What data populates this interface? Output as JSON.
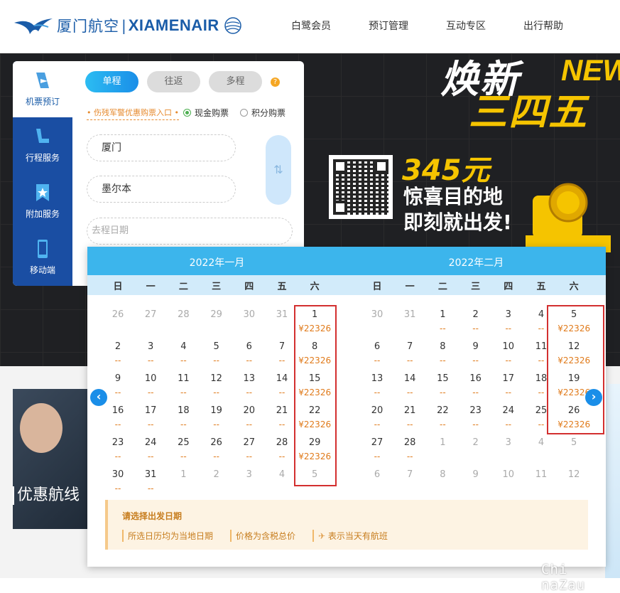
{
  "header": {
    "logo_cn": "厦门航空",
    "logo_en": "XIAMENAIR",
    "nav": [
      "白鹭会员",
      "预订管理",
      "互动专区",
      "出行帮助"
    ]
  },
  "banner": {
    "title1": "焕新",
    "title_new": "NEW",
    "title2": "三四五",
    "price": "345元",
    "line1": "惊喜目的地",
    "line2": "即刻就出发!"
  },
  "booking": {
    "side_items": [
      {
        "label": "机票预订",
        "icon": "plane-ticket-icon"
      },
      {
        "label": "行程服务",
        "icon": "seat-icon"
      },
      {
        "label": "附加服务",
        "icon": "bookmark-star-icon"
      },
      {
        "label": "移动端",
        "icon": "mobile-phone-icon"
      }
    ],
    "tabs": [
      "单程",
      "往返",
      "多程"
    ],
    "help": "?",
    "promo_link": "伤残军警优惠购票入口",
    "radio_cash": "现金购票",
    "radio_points": "积分购票",
    "from": "厦门",
    "to": "墨尔本",
    "swap": "⇅",
    "date_placeholder": "去程日期"
  },
  "calendar": {
    "months": [
      {
        "title": "2022年一月",
        "weekdays": [
          "日",
          "一",
          "二",
          "三",
          "四",
          "五",
          "六"
        ],
        "days": [
          {
            "n": "26",
            "p": "",
            "t": "gray"
          },
          {
            "n": "27",
            "p": "",
            "t": "gray"
          },
          {
            "n": "28",
            "p": "",
            "t": "gray"
          },
          {
            "n": "29",
            "p": "",
            "t": "gray"
          },
          {
            "n": "30",
            "p": "",
            "t": "gray"
          },
          {
            "n": "31",
            "p": "",
            "t": "gray"
          },
          {
            "n": "1",
            "p": "¥22326",
            "t": ""
          },
          {
            "n": "2",
            "p": "--",
            "t": ""
          },
          {
            "n": "3",
            "p": "--",
            "t": ""
          },
          {
            "n": "4",
            "p": "--",
            "t": ""
          },
          {
            "n": "5",
            "p": "--",
            "t": ""
          },
          {
            "n": "6",
            "p": "--",
            "t": ""
          },
          {
            "n": "7",
            "p": "--",
            "t": ""
          },
          {
            "n": "8",
            "p": "¥22326",
            "t": ""
          },
          {
            "n": "9",
            "p": "--",
            "t": ""
          },
          {
            "n": "10",
            "p": "--",
            "t": ""
          },
          {
            "n": "11",
            "p": "--",
            "t": ""
          },
          {
            "n": "12",
            "p": "--",
            "t": ""
          },
          {
            "n": "13",
            "p": "--",
            "t": ""
          },
          {
            "n": "14",
            "p": "--",
            "t": ""
          },
          {
            "n": "15",
            "p": "¥22326",
            "t": ""
          },
          {
            "n": "16",
            "p": "--",
            "t": ""
          },
          {
            "n": "17",
            "p": "--",
            "t": ""
          },
          {
            "n": "18",
            "p": "--",
            "t": ""
          },
          {
            "n": "19",
            "p": "--",
            "t": ""
          },
          {
            "n": "20",
            "p": "--",
            "t": ""
          },
          {
            "n": "21",
            "p": "--",
            "t": ""
          },
          {
            "n": "22",
            "p": "¥22326",
            "t": ""
          },
          {
            "n": "23",
            "p": "--",
            "t": ""
          },
          {
            "n": "24",
            "p": "--",
            "t": ""
          },
          {
            "n": "25",
            "p": "--",
            "t": ""
          },
          {
            "n": "26",
            "p": "--",
            "t": ""
          },
          {
            "n": "27",
            "p": "--",
            "t": ""
          },
          {
            "n": "28",
            "p": "--",
            "t": ""
          },
          {
            "n": "29",
            "p": "¥22326",
            "t": ""
          },
          {
            "n": "30",
            "p": "--",
            "t": ""
          },
          {
            "n": "31",
            "p": "--",
            "t": ""
          },
          {
            "n": "1",
            "p": "",
            "t": "gray"
          },
          {
            "n": "2",
            "p": "",
            "t": "gray"
          },
          {
            "n": "3",
            "p": "",
            "t": "gray"
          },
          {
            "n": "4",
            "p": "",
            "t": "gray"
          },
          {
            "n": "5",
            "p": "",
            "t": "gray"
          }
        ]
      },
      {
        "title": "2022年二月",
        "weekdays": [
          "日",
          "一",
          "二",
          "三",
          "四",
          "五",
          "六"
        ],
        "days": [
          {
            "n": "30",
            "p": "",
            "t": "gray"
          },
          {
            "n": "31",
            "p": "",
            "t": "gray"
          },
          {
            "n": "1",
            "p": "--",
            "t": ""
          },
          {
            "n": "2",
            "p": "--",
            "t": ""
          },
          {
            "n": "3",
            "p": "--",
            "t": ""
          },
          {
            "n": "4",
            "p": "--",
            "t": ""
          },
          {
            "n": "5",
            "p": "¥22326",
            "t": ""
          },
          {
            "n": "6",
            "p": "--",
            "t": ""
          },
          {
            "n": "7",
            "p": "--",
            "t": ""
          },
          {
            "n": "8",
            "p": "--",
            "t": ""
          },
          {
            "n": "9",
            "p": "--",
            "t": ""
          },
          {
            "n": "10",
            "p": "--",
            "t": ""
          },
          {
            "n": "11",
            "p": "--",
            "t": ""
          },
          {
            "n": "12",
            "p": "¥22326",
            "t": ""
          },
          {
            "n": "13",
            "p": "--",
            "t": ""
          },
          {
            "n": "14",
            "p": "--",
            "t": ""
          },
          {
            "n": "15",
            "p": "--",
            "t": ""
          },
          {
            "n": "16",
            "p": "--",
            "t": ""
          },
          {
            "n": "17",
            "p": "--",
            "t": ""
          },
          {
            "n": "18",
            "p": "--",
            "t": ""
          },
          {
            "n": "19",
            "p": "¥22326",
            "t": ""
          },
          {
            "n": "20",
            "p": "--",
            "t": ""
          },
          {
            "n": "21",
            "p": "--",
            "t": ""
          },
          {
            "n": "22",
            "p": "--",
            "t": ""
          },
          {
            "n": "23",
            "p": "--",
            "t": ""
          },
          {
            "n": "24",
            "p": "--",
            "t": ""
          },
          {
            "n": "25",
            "p": "--",
            "t": ""
          },
          {
            "n": "26",
            "p": "¥22326",
            "t": ""
          },
          {
            "n": "27",
            "p": "--",
            "t": ""
          },
          {
            "n": "28",
            "p": "--",
            "t": ""
          },
          {
            "n": "1",
            "p": "",
            "t": "gray"
          },
          {
            "n": "2",
            "p": "",
            "t": "gray"
          },
          {
            "n": "3",
            "p": "",
            "t": "gray"
          },
          {
            "n": "4",
            "p": "",
            "t": "gray"
          },
          {
            "n": "5",
            "p": "",
            "t": "gray"
          },
          {
            "n": "6",
            "p": "",
            "t": "gray"
          },
          {
            "n": "7",
            "p": "",
            "t": "gray"
          },
          {
            "n": "8",
            "p": "",
            "t": "gray"
          },
          {
            "n": "9",
            "p": "",
            "t": "gray"
          },
          {
            "n": "10",
            "p": "",
            "t": "gray"
          },
          {
            "n": "11",
            "p": "",
            "t": "gray"
          },
          {
            "n": "12",
            "p": "",
            "t": "gray"
          }
        ]
      }
    ],
    "prev": "‹",
    "next": "›",
    "note_title": "请选择出发日期",
    "note_items": [
      "所选日历均为当地日期",
      "价格为含税总价",
      "表示当天有航班"
    ],
    "note_plane_icon": "plane-icon"
  },
  "promo_card": {
    "text": "优惠航线"
  },
  "watermark": "Chi naZau",
  "colors": {
    "brand": "#1a5ca8",
    "accent": "#3cb5ec",
    "price": "#e07a1a",
    "highlight": "#d32f2f"
  }
}
